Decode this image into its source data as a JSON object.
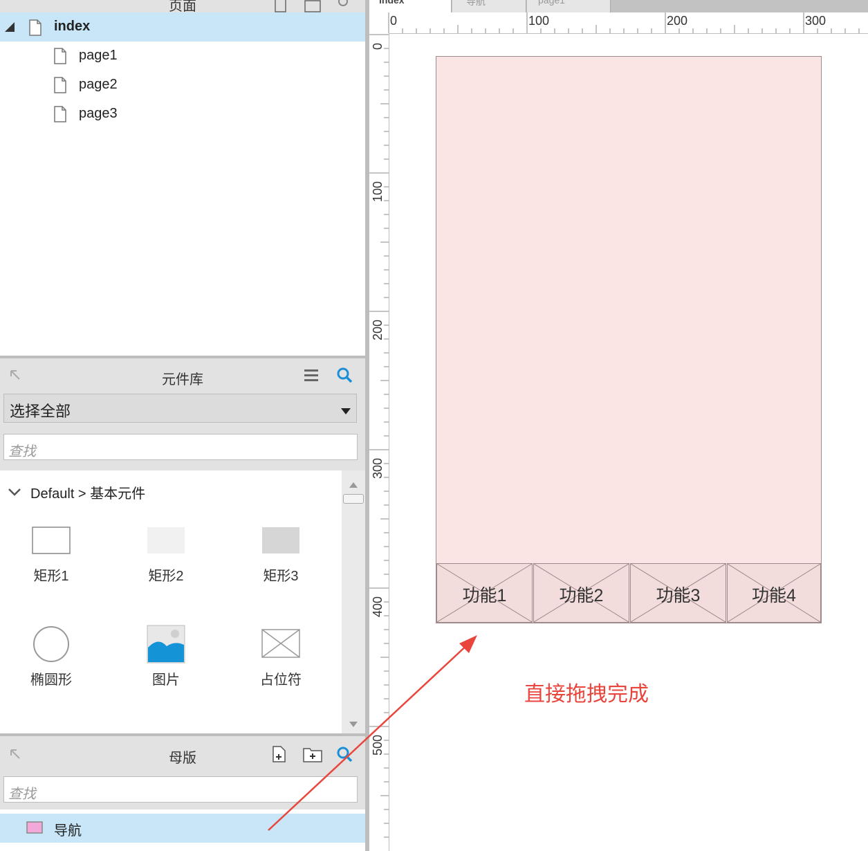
{
  "pages_panel": {
    "title": "页面",
    "items": [
      {
        "label": "index"
      },
      {
        "label": "page1"
      },
      {
        "label": "page2"
      },
      {
        "label": "page3"
      }
    ]
  },
  "library_panel": {
    "title": "元件库",
    "selector_value": "选择全部",
    "search_placeholder": "查找",
    "group_label": "Default > 基本元件",
    "widgets": [
      {
        "label": "矩形1"
      },
      {
        "label": "矩形2"
      },
      {
        "label": "矩形3"
      },
      {
        "label": "椭圆形"
      },
      {
        "label": "图片"
      },
      {
        "label": "占位符"
      }
    ]
  },
  "masters_panel": {
    "title": "母版",
    "search_placeholder": "查找",
    "items": [
      {
        "label": "导航"
      }
    ]
  },
  "tabs": [
    {
      "label": "index"
    },
    {
      "label": "导航"
    },
    {
      "label": "page1"
    }
  ],
  "ruler": {
    "h_labels": [
      "0",
      "100",
      "200",
      "300"
    ],
    "v_labels": [
      "0",
      "100",
      "200",
      "300",
      "400",
      "500"
    ]
  },
  "canvas": {
    "nav_items": [
      {
        "label": "功能1"
      },
      {
        "label": "功能2"
      },
      {
        "label": "功能3"
      },
      {
        "label": "功能4"
      }
    ],
    "annotation": "直接拖拽完成"
  },
  "colors": {
    "selected_row": "#c8e6f7",
    "mock_bg": "#fbe4e4",
    "accent_blue": "#1b8fd6",
    "annotation_red": "#e8453c"
  }
}
